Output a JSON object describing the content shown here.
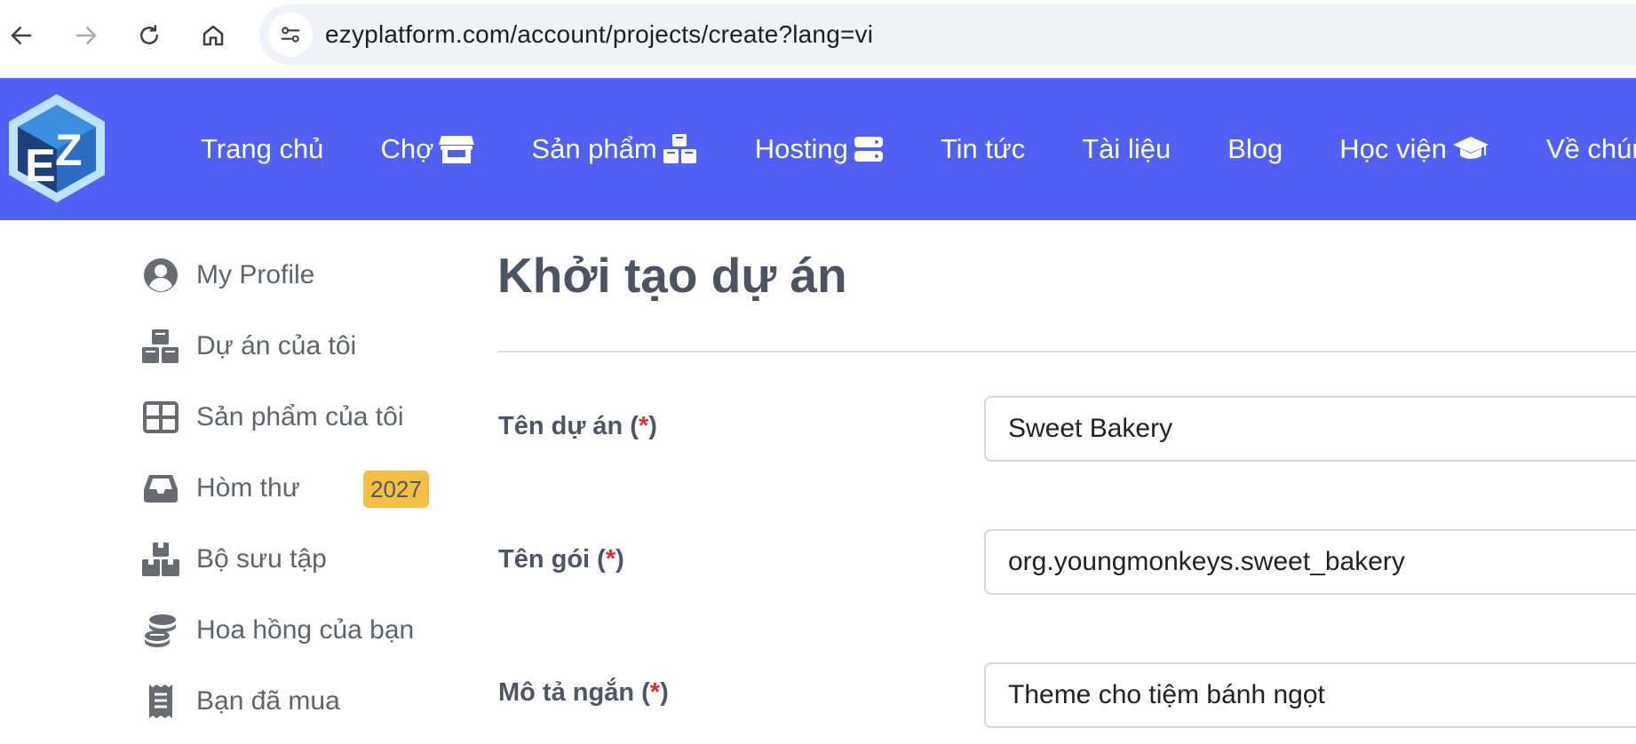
{
  "browser": {
    "url": "ezyplatform.com/account/projects/create?lang=vi"
  },
  "header": {
    "nav": [
      {
        "label": "Trang chủ",
        "icon": ""
      },
      {
        "label": "Chợ",
        "icon": "store-icon"
      },
      {
        "label": "Sản phẩm",
        "icon": "cubes-icon"
      },
      {
        "label": "Hosting",
        "icon": "server-icon"
      },
      {
        "label": "Tin tức",
        "icon": ""
      },
      {
        "label": "Tài liệu",
        "icon": ""
      },
      {
        "label": "Blog",
        "icon": ""
      },
      {
        "label": "Học viện",
        "icon": "graduation-cap-icon"
      },
      {
        "label": "Về chúng tôi",
        "icon": ""
      }
    ]
  },
  "sidebar": {
    "items": [
      {
        "label": "My Profile",
        "icon": "user-circle-icon"
      },
      {
        "label": "Dự án của tôi",
        "icon": "cubes-icon"
      },
      {
        "label": "Sản phẩm của tôi",
        "icon": "grid-icon"
      },
      {
        "label": "Hòm thư",
        "icon": "inbox-icon",
        "badge": "2027"
      },
      {
        "label": "Bộ sưu tập",
        "icon": "boxes-icon"
      },
      {
        "label": "Hoa hồng của bạn",
        "icon": "coins-icon"
      },
      {
        "label": "Bạn đã mua",
        "icon": "receipt-icon"
      }
    ]
  },
  "main": {
    "title": "Khởi tạo dự án",
    "fields": [
      {
        "label": "Tên dự án",
        "value": "Sweet Bakery"
      },
      {
        "label": "Tên gói",
        "value": "org.youngmonkeys.sweet_bakery"
      },
      {
        "label": "Mô tả ngắn",
        "value": "Theme cho tiệm bánh ngọt"
      }
    ],
    "required_marker": "*"
  },
  "colors": {
    "header_bg": "#4f60f5",
    "badge_bg": "#f5bf42",
    "required": "#d4313d",
    "sidebar_text": "#5f646b",
    "title_text": "#4c5363"
  }
}
